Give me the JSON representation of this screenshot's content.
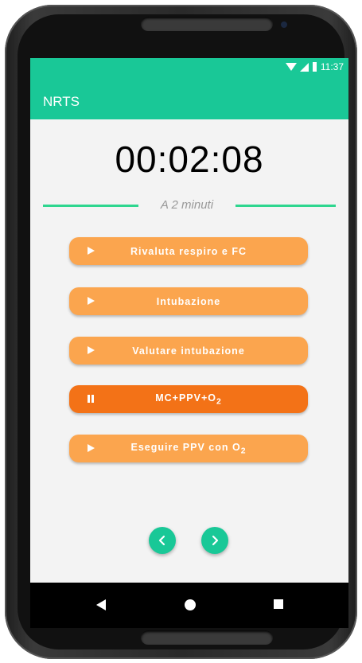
{
  "status": {
    "time": "11:37"
  },
  "app": {
    "title": "NRTS"
  },
  "timer": {
    "value": "00:02:08"
  },
  "section": {
    "caption": "A 2 minuti"
  },
  "actions": [
    {
      "label": "Rivaluta respiro e FC",
      "state": "play"
    },
    {
      "label": "Intubazione",
      "state": "play"
    },
    {
      "label": "Valutare intubazione",
      "state": "play"
    },
    {
      "label": "MC+PPV+O",
      "subscript": "2",
      "state": "pause"
    },
    {
      "label": "Eseguire PPV con O",
      "subscript": "2",
      "state": "play"
    }
  ],
  "colors": {
    "accent": "#19c897",
    "button": "#fba54e",
    "button_active": "#f37217",
    "divider": "#2ed68f"
  },
  "icons": {
    "prev": "chevron-left-icon",
    "next": "chevron-right-icon",
    "play": "play-icon",
    "pause": "pause-icon"
  }
}
